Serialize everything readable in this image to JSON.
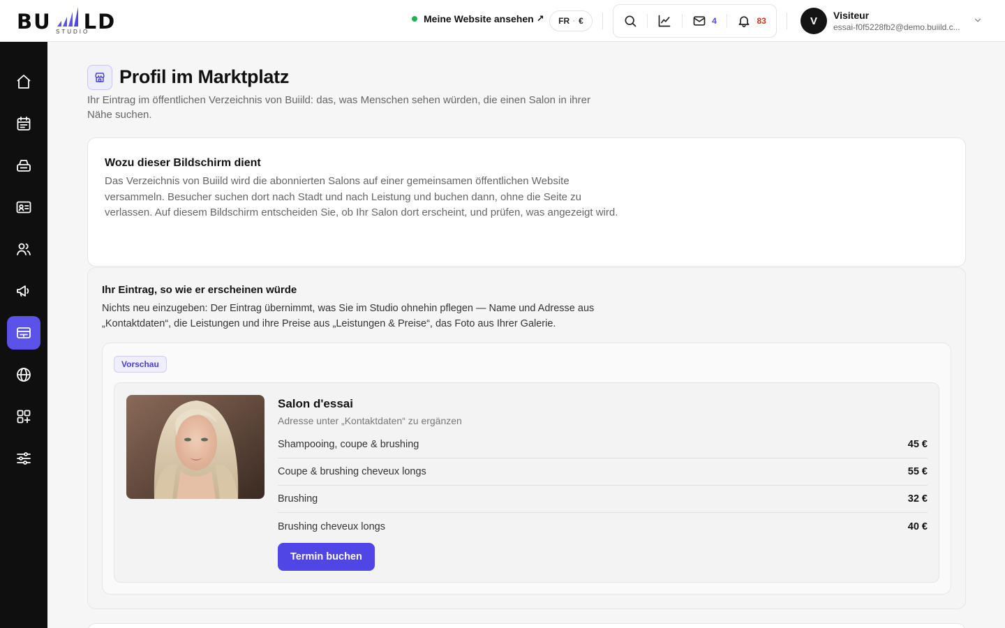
{
  "header": {
    "logo_text": "BUIILD",
    "logo_sub": "STUDIO",
    "site_link_label": "Meine Website ansehen",
    "lang_code": "FR",
    "currency": "€",
    "messages_count": "4",
    "notifications_count": "83",
    "user": {
      "initial": "V",
      "name": "Visiteur",
      "email": "essai-f0f5228fb2@demo.buiild.c..."
    }
  },
  "sidebar": {
    "items": [
      {
        "icon": "home-icon"
      },
      {
        "icon": "calendar-icon"
      },
      {
        "icon": "cash-register-icon"
      },
      {
        "icon": "contact-card-icon"
      },
      {
        "icon": "users-icon"
      },
      {
        "icon": "megaphone-icon"
      },
      {
        "icon": "marketplace-card-icon",
        "active": true
      },
      {
        "icon": "globe-icon"
      },
      {
        "icon": "apps-add-icon"
      },
      {
        "icon": "sliders-icon"
      }
    ]
  },
  "page": {
    "title": "Profil im Marktplatz",
    "subtitle": "Ihr Eintrag im öffentlichen Verzeichnis von Buiild: das, was Menschen sehen würden, die einen Salon in ihrer Nähe suchen."
  },
  "info_card": {
    "title": "Wozu dieser Bildschirm dient",
    "body": "Das Verzeichnis von Buiild wird die abonnierten Salons auf einer gemeinsamen öffentlichen Website versammeln. Besucher suchen dort nach Stadt und nach Leistung und buchen dann, ohne die Seite zu verlassen. Auf diesem Bildschirm entscheiden Sie, ob Ihr Salon dort erscheint, und prüfen, was angezeigt wird."
  },
  "listing_card": {
    "title": "Ihr Eintrag, so wie er erscheinen würde",
    "intro": "Nichts neu einzugeben: Der Eintrag übernimmt, was Sie im Studio ohnehin pflegen — Name und Adresse aus „Kontaktdaten“, die Leistungen und ihre Preise aus „Leistungen & Preise“, das Foto aus Ihrer Galerie.",
    "badge": "Vorschau",
    "salon_name": "Salon d'essai",
    "salon_address": "Adresse unter „Kontaktdaten“ zu ergänzen",
    "services": [
      {
        "name": "Shampooing, coupe & brushing",
        "price": "45 €"
      },
      {
        "name": "Coupe & brushing cheveux longs",
        "price": "55 €"
      },
      {
        "name": "Brushing",
        "price": "32 €"
      },
      {
        "name": "Brushing cheveux longs",
        "price": "40 €"
      }
    ],
    "book_button": "Termin buchen"
  },
  "colors": {
    "accent": "#4f46e5",
    "sidebar_bg": "#0f0f10",
    "status_online": "#22b15a",
    "notification_count": "#d92d20",
    "message_count": "#4f46e5"
  }
}
